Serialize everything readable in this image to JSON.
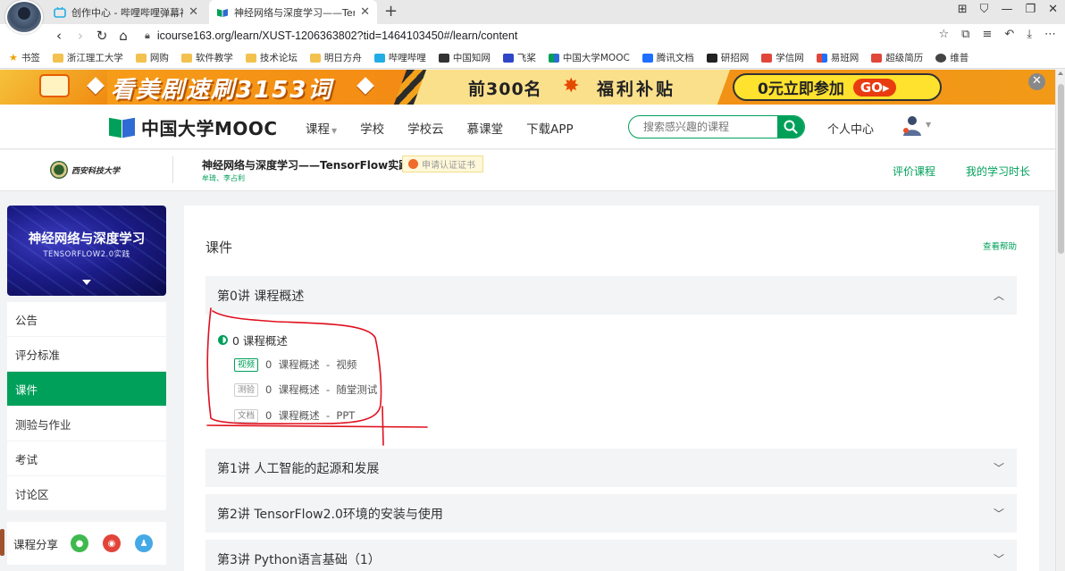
{
  "browser": {
    "tabs": [
      {
        "title": "创作中心 - 哔哩哔哩弹幕视频网 - (",
        "active": false
      },
      {
        "title": "神经网络与深度学习——TensorF",
        "active": true
      }
    ],
    "new_tab": "+",
    "url": "icourse163.org/learn/XUST-1206363802?tid=1464103450#/learn/content",
    "bookmarks": [
      "书签",
      "浙江理工大学",
      "网购",
      "软件教学",
      "技术论坛",
      "明日方舟",
      "哔哩哔哩",
      "中国知网",
      "飞桨",
      "中国大学MOOC",
      "腾讯文档",
      "研招网",
      "学信网",
      "易班网",
      "超级简历",
      "维普"
    ]
  },
  "banner": {
    "slogan": "看美剧速刷3153词",
    "top": "前300名",
    "welfare": "福利补贴",
    "cta": "0元立即参加",
    "go": "GO"
  },
  "header": {
    "logo": "中国大学MOOC",
    "nav": [
      "课程",
      "学校",
      "学校云",
      "慕课堂",
      "下载APP"
    ],
    "search_placeholder": "搜索感兴趣的课程",
    "personal": "个人中心"
  },
  "course": {
    "university_name": "西安科技大学",
    "title": "神经网络与深度学习——TensorFlow实践",
    "teachers": "牟琦、李占利",
    "cert": "申请认证证书",
    "eval": "评价课程",
    "study_time": "我的学习时长"
  },
  "sidebar": {
    "cover_title": "神经网络与深度学习",
    "cover_subtitle": "TENSORFLOW2.0实践",
    "items": [
      "公告",
      "评分标准",
      "课件",
      "测验与作业",
      "考试",
      "讨论区"
    ],
    "active_index": 2,
    "share_label": "课程分享"
  },
  "main": {
    "title": "课件",
    "help": "查看帮助",
    "chapters": [
      {
        "title": "第0讲 课程概述",
        "expanded": true
      },
      {
        "title": "第1讲 人工智能的起源和发展",
        "expanded": false
      },
      {
        "title": "第2讲 TensorFlow2.0环境的安装与使用",
        "expanded": false
      },
      {
        "title": "第3讲 Python语言基础（1）",
        "expanded": false
      }
    ],
    "lesson": "0 课程概述",
    "units": [
      {
        "badge": "视频",
        "text": "0  课程概述  -  视频"
      },
      {
        "badge": "测验",
        "text": "0  课程概述  -  随堂测试"
      },
      {
        "badge": "文档",
        "text": "0  课程概述  -  PPT"
      }
    ]
  },
  "colors": {
    "brand_green": "#00a05a",
    "annotation_red": "#e0101e",
    "banner_orange": "#f38a13"
  }
}
